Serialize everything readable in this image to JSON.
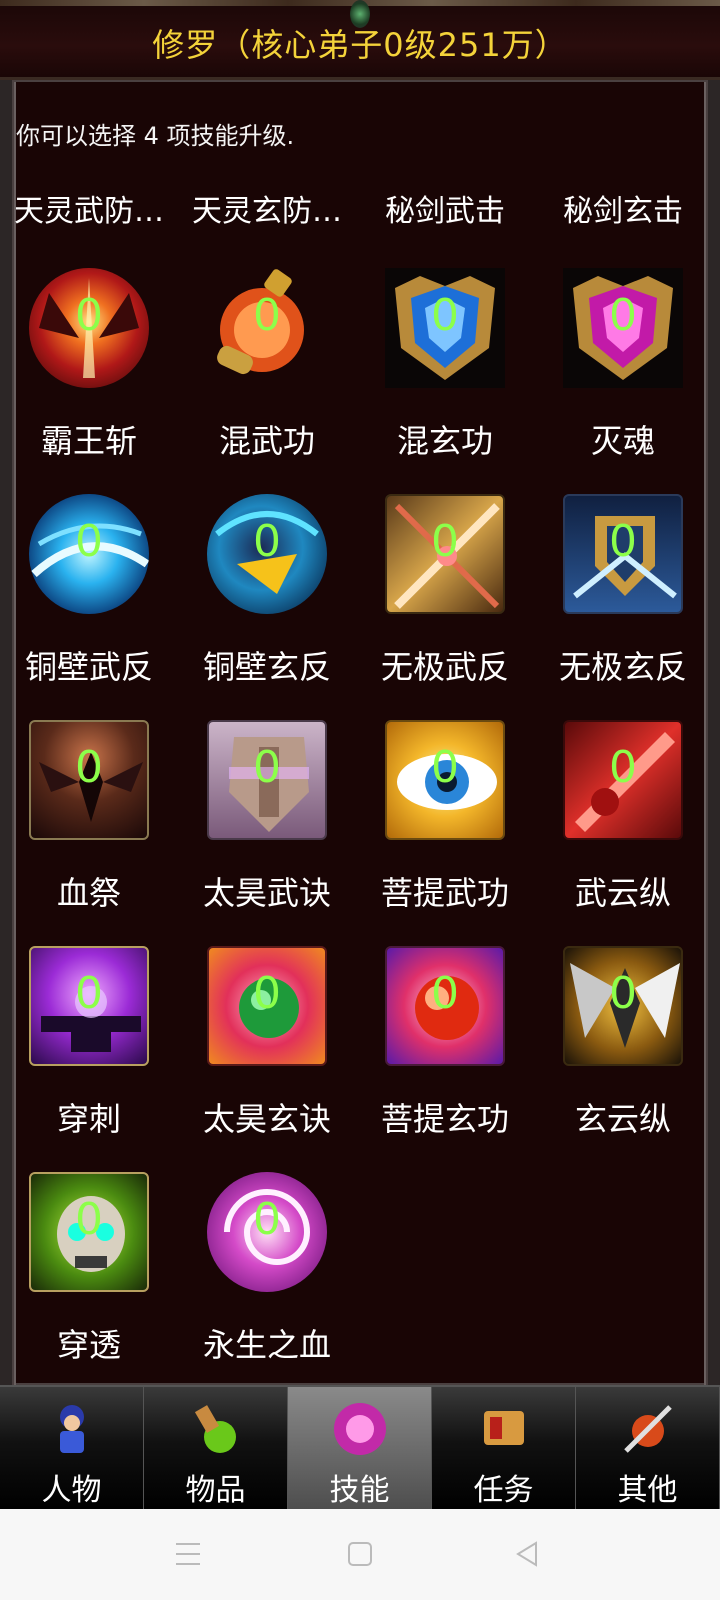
{
  "header": {
    "title": "修罗（核心弟子0级251万）"
  },
  "hint": "你可以选择 4 项技能升级.",
  "top_labels": [
    "天灵武防…",
    "天灵玄防…",
    "秘剑武击",
    "秘剑玄击"
  ],
  "skills": [
    {
      "name": "霸王斩",
      "level": "0",
      "icon": "flame-slash-icon"
    },
    {
      "name": "混武功",
      "level": "0",
      "icon": "potion-flask-icon"
    },
    {
      "name": "混玄功",
      "level": "0",
      "icon": "blue-gem-crest-icon"
    },
    {
      "name": "灭魂",
      "level": "0",
      "icon": "pink-gem-crest-icon"
    },
    {
      "name": "铜壁武反",
      "level": "0",
      "icon": "blue-swirl-icon"
    },
    {
      "name": "铜壁玄反",
      "level": "0",
      "icon": "teal-vortex-icon"
    },
    {
      "name": "无极武反",
      "level": "0",
      "icon": "crossed-sword-icon"
    },
    {
      "name": "无极玄反",
      "level": "0",
      "icon": "ice-shield-icon"
    },
    {
      "name": "血祭",
      "level": "0",
      "icon": "dark-wings-icon"
    },
    {
      "name": "太昊武诀",
      "level": "0",
      "icon": "armor-chest-icon"
    },
    {
      "name": "菩提武功",
      "level": "0",
      "icon": "golden-eye-icon"
    },
    {
      "name": "武云纵",
      "level": "0",
      "icon": "red-blade-icon"
    },
    {
      "name": "穿刺",
      "level": "0",
      "icon": "purple-portal-icon"
    },
    {
      "name": "太昊玄诀",
      "level": "0",
      "icon": "green-orb-icon"
    },
    {
      "name": "菩提玄功",
      "level": "0",
      "icon": "red-orb-icon"
    },
    {
      "name": "玄云纵",
      "level": "0",
      "icon": "winged-emblem-icon"
    },
    {
      "name": "穿透",
      "level": "0",
      "icon": "green-skull-icon"
    },
    {
      "name": "永生之血",
      "level": "0",
      "icon": "pink-spiral-icon"
    }
  ],
  "tabs": [
    {
      "label": "人物",
      "icon": "character-icon"
    },
    {
      "label": "物品",
      "icon": "potion-icon"
    },
    {
      "label": "技能",
      "icon": "skill-orb-icon"
    },
    {
      "label": "任务",
      "icon": "quest-scroll-icon"
    },
    {
      "label": "其他",
      "icon": "sword-shield-icon"
    }
  ],
  "active_tab": "技能",
  "colors": {
    "title": "#f4d33a",
    "level": "#8cff4a",
    "background": "#190505"
  }
}
